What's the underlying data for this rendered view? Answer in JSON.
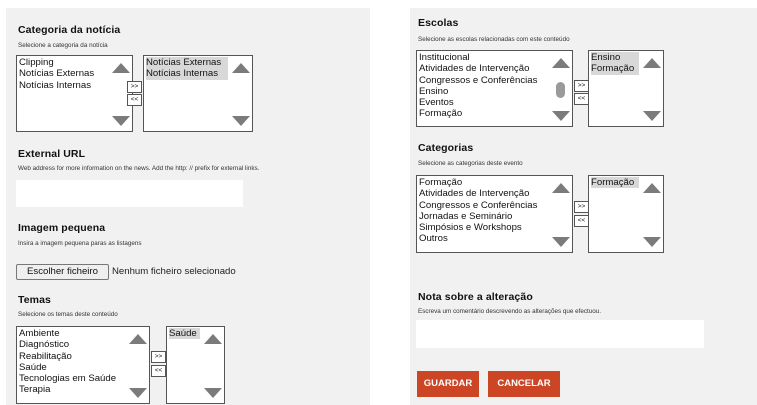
{
  "theme": {
    "accent": "#cc4625",
    "panel_bg": "#f1f1f1",
    "scroll_arrow": "#7b7b7b"
  },
  "move_buttons": {
    "add": ">>",
    "remove": "<<"
  },
  "categoria": {
    "title": "Categoria da notícia",
    "description": "Selecione a categoria da notícia",
    "available": [
      "Clipping",
      "Notícias Externas",
      "Notícias Internas"
    ],
    "selected": [
      "Notícias Externas",
      "Notícias Internas"
    ]
  },
  "external_url": {
    "title": "External URL",
    "description": "Web address for more information on the news. Add the http: // prefix for external links.",
    "value": ""
  },
  "imagem": {
    "title": "Imagem pequena",
    "description": "Insira a imagem pequena paras as listagens",
    "button": "Escolher ficheiro",
    "status": "Nenhum ficheiro selecionado"
  },
  "temas": {
    "title": "Temas",
    "description": "Selecione os temas deste conteúdo",
    "available": [
      "Ambiente",
      "Diagnóstico",
      "Reabilitação",
      "Saúde",
      "Tecnologias em Saúde",
      "Terapia"
    ],
    "selected": [
      "Saúde"
    ]
  },
  "escolas": {
    "title": "Escolas",
    "description": "Selecione as escolas relacionadas com este conteúdo",
    "available": [
      "Institucional",
      "Atividades de Intervenção",
      "Congressos e Conferências",
      "Ensino",
      "Eventos",
      "Formação"
    ],
    "selected": [
      "Ensino",
      "Formação"
    ]
  },
  "categorias": {
    "title": "Categorias",
    "description": "Selecione as categorias deste evento",
    "available": [
      "Formação",
      "Atividades de Intervenção",
      "Congressos e Conferências",
      "Jornadas e Seminário",
      "Simpósios e Workshops",
      "Outros"
    ],
    "selected": [
      "Formação"
    ]
  },
  "nota": {
    "title": "Nota sobre a alteração",
    "description": "Escreva um comentário descrevendo as alterações que efectuou.",
    "value": ""
  },
  "actions": {
    "save": "GUARDAR",
    "cancel": "CANCELAR"
  }
}
